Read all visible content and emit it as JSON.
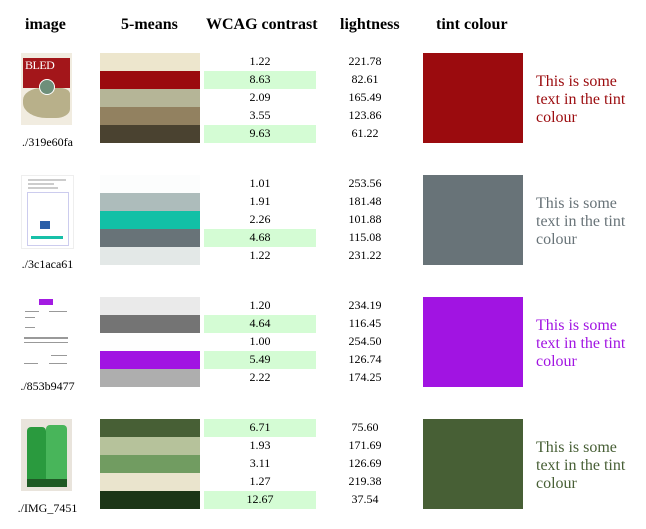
{
  "headers": {
    "image": "image",
    "kmeans": "5-means",
    "contrast": "WCAG contrast",
    "lightness": "lightness",
    "tint": "tint colour"
  },
  "contrast_pass_color": "#d4fcd4",
  "rows": [
    {
      "caption": "./319e60fa",
      "thumbnail": "bled-book-cover",
      "swatches": [
        "#ede6cd",
        "#9b0b0e",
        "#b5b597",
        "#928160",
        "#4a4230"
      ],
      "contrast": [
        "1.22",
        "8.63",
        "2.09",
        "3.55",
        "9.63"
      ],
      "contrast_pass": [
        false,
        true,
        false,
        false,
        true
      ],
      "lightness": [
        "221.78",
        "82.61",
        "165.49",
        "123.86",
        "61.22"
      ],
      "tint_color": "#9b0b0e",
      "tint_text": "This is some text in the tint colour"
    },
    {
      "caption": "./3c1aca61",
      "thumbnail": "email-screenshot",
      "swatches": [
        "#fcfdfd",
        "#adbcbb",
        "#12c0a6",
        "#687378",
        "#e3e8e7"
      ],
      "contrast": [
        "1.01",
        "1.91",
        "2.26",
        "4.68",
        "1.22"
      ],
      "contrast_pass": [
        false,
        false,
        false,
        true,
        false
      ],
      "lightness": [
        "253.56",
        "181.48",
        "101.88",
        "115.08",
        "231.22"
      ],
      "tint_color": "#687378",
      "tint_text": "This is some text in the tint colour"
    },
    {
      "caption": "./853b9477",
      "thumbnail": "invoice-document",
      "swatches": [
        "#eaeaea",
        "#747474",
        "#fefefe",
        "#a114e2",
        "#aeaeae"
      ],
      "contrast": [
        "1.20",
        "4.64",
        "1.00",
        "5.49",
        "2.22"
      ],
      "contrast_pass": [
        false,
        true,
        false,
        true,
        false
      ],
      "lightness": [
        "234.19",
        "116.45",
        "254.50",
        "126.74",
        "174.25"
      ],
      "tint_color": "#a114e2",
      "tint_text": "This is some text in the tint colour"
    },
    {
      "caption": "./IMG_7451",
      "thumbnail": "green-train-seats",
      "swatches": [
        "#475f35",
        "#b6c29b",
        "#719c61",
        "#eae4cd",
        "#1c3517"
      ],
      "contrast": [
        "6.71",
        "1.93",
        "3.11",
        "1.27",
        "12.67"
      ],
      "contrast_pass": [
        true,
        false,
        false,
        false,
        true
      ],
      "lightness": [
        "75.60",
        "171.69",
        "126.69",
        "219.38",
        "37.54"
      ],
      "tint_color": "#475f35",
      "tint_text": "This is some text in the tint colour"
    }
  ]
}
